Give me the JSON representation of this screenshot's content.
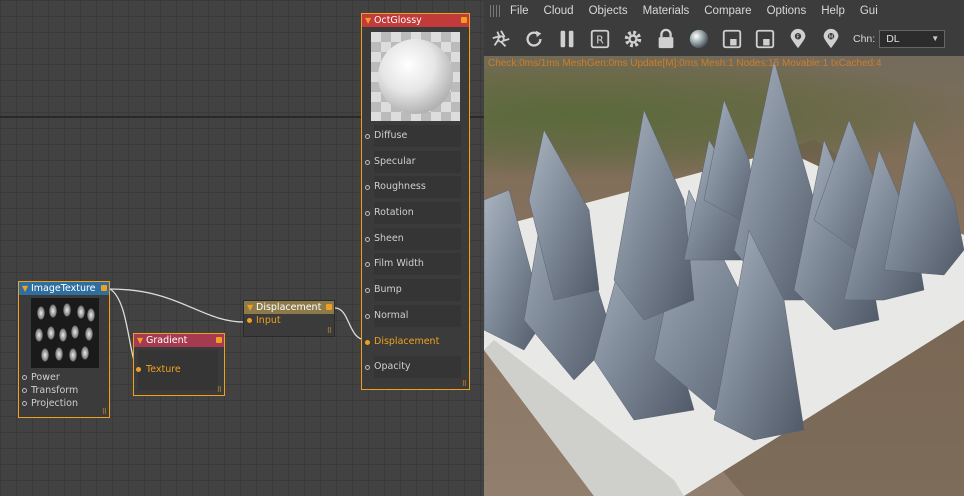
{
  "node_editor": {
    "nodes": {
      "octglossy": {
        "title": "OctGlossy",
        "pins": [
          "Diffuse",
          "Specular",
          "Roughness",
          "Rotation",
          "Sheen",
          "Film Width",
          "Bump",
          "Normal",
          "Displacement",
          "Opacity"
        ],
        "active_pin": "Displacement"
      },
      "imagetexture": {
        "title": "ImageTexture",
        "pins": [
          "Power",
          "Transform",
          "Projection"
        ]
      },
      "gradient": {
        "title": "Gradient",
        "pin": "Texture"
      },
      "displacement": {
        "title": "Displacement",
        "pin": "Input"
      }
    },
    "colors": {
      "accent": "#f0a020",
      "octglossy_header": "#c23a3a",
      "imagetexture_header": "#2f6fa0",
      "gradient_header": "#a63a50",
      "displacement_header": "#8d7a4a"
    }
  },
  "viewport": {
    "menu": [
      "File",
      "Cloud",
      "Objects",
      "Materials",
      "Compare",
      "Options",
      "Help",
      "Gui"
    ],
    "toolbar_icons": [
      "aperture-icon",
      "refresh-icon",
      "pause-icon",
      "region-render-icon",
      "settings-gear-icon",
      "lock-icon",
      "material-ball-icon",
      "focus-picker-icon",
      "material-picker-icon",
      "focus-pin-icon",
      "material-pin-icon"
    ],
    "channel": {
      "label": "Chn:",
      "value": "DL"
    },
    "status": "Check:0ms/1ms  MeshGen:0ms  Update[M]:0ms  Mesh:1  Nodes:15  Movable:1  txCached:4"
  }
}
